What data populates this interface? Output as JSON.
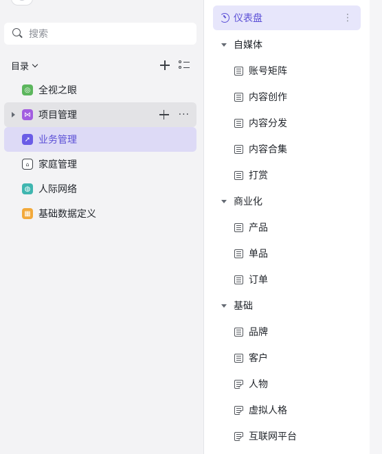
{
  "sidebar": {
    "search_placeholder": "搜索",
    "directory_label": "目录",
    "items": [
      {
        "label": "全视之眼",
        "icon": "eye-app-icon",
        "color": "#5cb65d"
      },
      {
        "label": "项目管理",
        "icon": "project-app-icon",
        "color": "#a25de0"
      },
      {
        "label": "业务管理",
        "icon": "compass-app-icon",
        "color": "#6a5ce6"
      },
      {
        "label": "家庭管理",
        "icon": "home-app-icon",
        "color": "#3b3f45"
      },
      {
        "label": "人际网络",
        "icon": "globe-app-icon",
        "color": "#3fb6b0"
      },
      {
        "label": "基础数据定义",
        "icon": "grid-app-icon",
        "color": "#f2a93b"
      }
    ],
    "more_label": "···"
  },
  "content": {
    "dashboard_label": "仪表盘",
    "more_label": "⋮",
    "groups": [
      {
        "label": "自媒体",
        "items": [
          {
            "label": "账号矩阵",
            "icon": "table-doc-icon"
          },
          {
            "label": "内容创作",
            "icon": "table-doc-icon"
          },
          {
            "label": "内容分发",
            "icon": "table-doc-icon"
          },
          {
            "label": "内容合集",
            "icon": "table-doc-icon"
          },
          {
            "label": "打赏",
            "icon": "table-doc-icon"
          }
        ]
      },
      {
        "label": "商业化",
        "items": [
          {
            "label": "产品",
            "icon": "table-doc-icon"
          },
          {
            "label": "单品",
            "icon": "table-doc-icon"
          },
          {
            "label": "订单",
            "icon": "table-doc-icon"
          }
        ]
      },
      {
        "label": "基础",
        "items": [
          {
            "label": "品牌",
            "icon": "table-doc-icon"
          },
          {
            "label": "客户",
            "icon": "table-doc-icon"
          },
          {
            "label": "人物",
            "icon": "table-edit-icon"
          },
          {
            "label": "虚拟人格",
            "icon": "table-edit-icon"
          },
          {
            "label": "互联网平台",
            "icon": "table-edit-icon"
          }
        ]
      }
    ]
  },
  "colors": {
    "accent": "#5b4fd6",
    "active_bg": "#dddaf6",
    "hover_bg": "#e3e3e6"
  }
}
